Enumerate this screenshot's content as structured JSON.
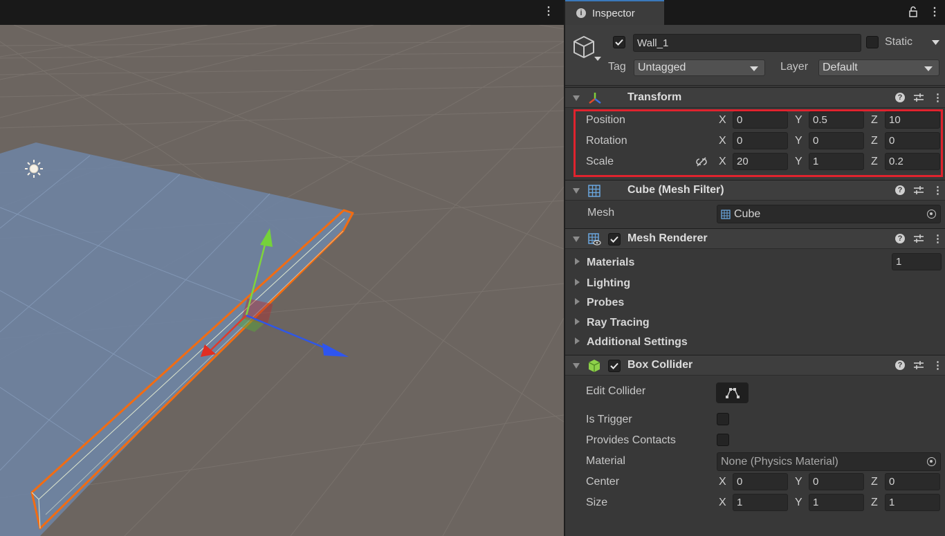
{
  "scene": {
    "menu_glyph": "⋮"
  },
  "inspector": {
    "tab_label": "Inspector",
    "tab_icon": "info-icon",
    "menu_glyph": "⋮",
    "object": {
      "active": true,
      "name": "Wall_1",
      "static_label": "Static",
      "static": false,
      "tag_label": "Tag",
      "tag_value": "Untagged",
      "layer_label": "Layer",
      "layer_value": "Default"
    },
    "transform": {
      "title": "Transform",
      "position": {
        "label": "Position",
        "x": "0",
        "y": "0.5",
        "z": "10"
      },
      "rotation": {
        "label": "Rotation",
        "x": "0",
        "y": "0",
        "z": "0"
      },
      "scale": {
        "label": "Scale",
        "x": "20",
        "y": "1",
        "z": "0.2"
      },
      "axis_x": "X",
      "axis_y": "Y",
      "axis_z": "Z"
    },
    "mesh_filter": {
      "title": "Cube (Mesh Filter)",
      "mesh_label": "Mesh",
      "mesh_value": "Cube"
    },
    "mesh_renderer": {
      "title": "Mesh Renderer",
      "enabled": true,
      "materials_label": "Materials",
      "materials_count": "1",
      "lighting_label": "Lighting",
      "probes_label": "Probes",
      "ray_tracing_label": "Ray Tracing",
      "additional_label": "Additional Settings"
    },
    "box_collider": {
      "title": "Box Collider",
      "enabled": true,
      "edit_collider_label": "Edit Collider",
      "is_trigger_label": "Is Trigger",
      "is_trigger": false,
      "provides_contacts_label": "Provides Contacts",
      "provides_contacts": false,
      "material_label": "Material",
      "material_value": "None (Physics Material)",
      "center": {
        "label": "Center",
        "x": "0",
        "y": "0",
        "z": "0"
      },
      "size": {
        "label": "Size",
        "x": "1",
        "y": "1",
        "z": "1"
      }
    },
    "help_glyph": "?",
    "colors": {
      "selection_outline": "#f26c12",
      "highlight_box": "#e0232e",
      "tab_accent": "#3a79bb"
    }
  }
}
